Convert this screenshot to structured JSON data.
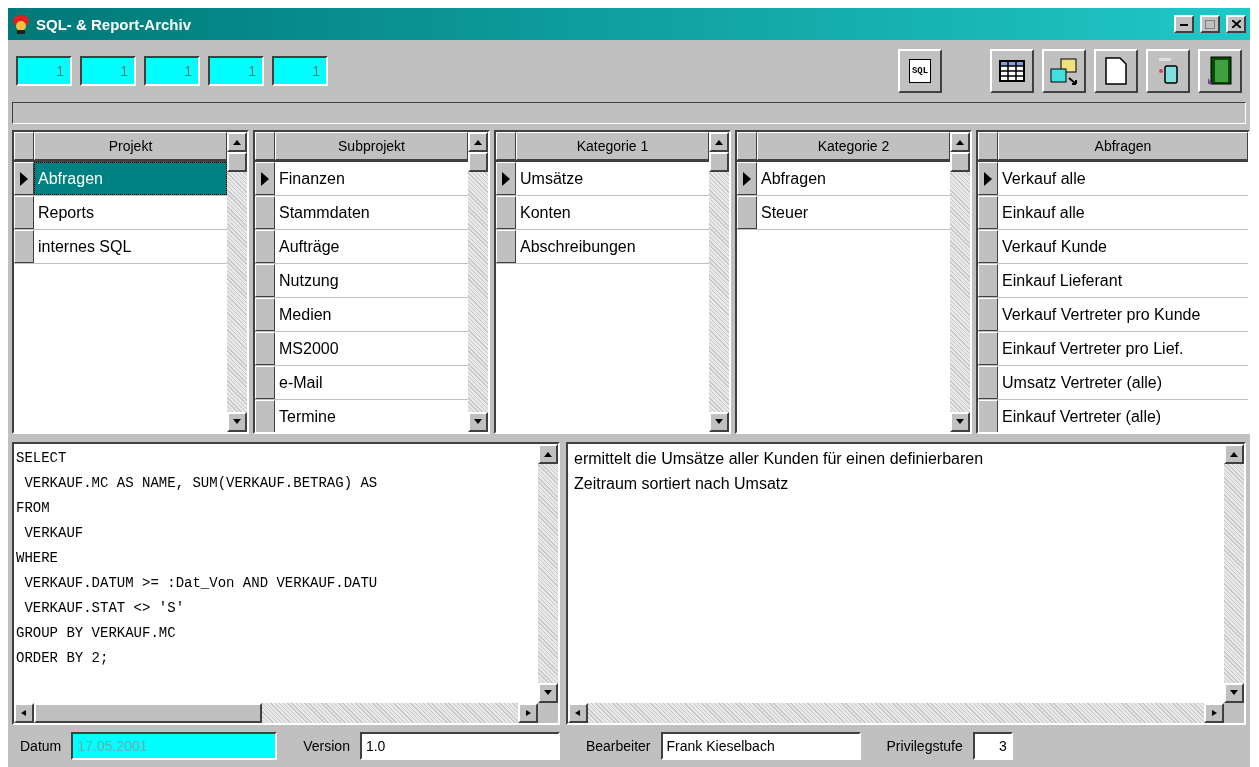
{
  "window": {
    "title": "SQL- & Report-Archiv"
  },
  "counters": [
    "1",
    "1",
    "1",
    "1",
    "1"
  ],
  "sql_button": {
    "label": "SQL"
  },
  "grids": [
    {
      "header": "Projekt",
      "focused": true,
      "scrollbar": true,
      "rows": [
        {
          "text": "Abfragen",
          "selected": true
        },
        {
          "text": "Reports",
          "selected": false
        },
        {
          "text": "internes SQL",
          "selected": false
        }
      ]
    },
    {
      "header": "Subprojekt",
      "focused": false,
      "scrollbar": true,
      "rows": [
        {
          "text": "Finanzen",
          "selected": true
        },
        {
          "text": "Stammdaten",
          "selected": false
        },
        {
          "text": "Aufträge",
          "selected": false
        },
        {
          "text": "Nutzung",
          "selected": false
        },
        {
          "text": "Medien",
          "selected": false
        },
        {
          "text": "MS2000",
          "selected": false
        },
        {
          "text": "e-Mail",
          "selected": false
        },
        {
          "text": "Termine",
          "selected": false
        }
      ]
    },
    {
      "header": "Kategorie 1",
      "focused": false,
      "scrollbar": true,
      "rows": [
        {
          "text": "Umsätze",
          "selected": true
        },
        {
          "text": "Konten",
          "selected": false
        },
        {
          "text": "Abschreibungen",
          "selected": false
        }
      ]
    },
    {
      "header": "Kategorie 2",
      "focused": false,
      "scrollbar": true,
      "rows": [
        {
          "text": "Abfragen",
          "selected": true
        },
        {
          "text": "Steuer",
          "selected": false
        }
      ]
    },
    {
      "header": "Abfragen",
      "focused": false,
      "scrollbar": false,
      "rows": [
        {
          "text": "Verkauf alle",
          "selected": true
        },
        {
          "text": "Einkauf alle",
          "selected": false
        },
        {
          "text": "Verkauf Kunde",
          "selected": false
        },
        {
          "text": "Einkauf Lieferant",
          "selected": false
        },
        {
          "text": "Verkauf Vertreter pro Kunde",
          "selected": false
        },
        {
          "text": "Einkauf Vertreter pro Lief.",
          "selected": false
        },
        {
          "text": "Umsatz Vertreter (alle)",
          "selected": false
        },
        {
          "text": "Einkauf Vertreter (alle)",
          "selected": false
        }
      ]
    }
  ],
  "sql_lines": [
    "SELECT",
    " VERKAUF.MC AS NAME, SUM(VERKAUF.BETRAG) AS",
    "FROM",
    " VERKAUF",
    "WHERE",
    " VERKAUF.DATUM >= :Dat_Von AND VERKAUF.DATU",
    " VERKAUF.STAT <> 'S'",
    "GROUP BY VERKAUF.MC",
    "ORDER BY 2;"
  ],
  "description_lines": [
    "ermittelt die Umsätze aller Kunden für einen definierbaren",
    "Zeitraum sortiert nach Umsatz"
  ],
  "status_fields": [
    {
      "label": "Datum",
      "value": "17.05.2001",
      "kind": "date",
      "disabled": true
    },
    {
      "label": "Version",
      "value": "1.0",
      "kind": "text",
      "disabled": false
    },
    {
      "label": "Bearbeiter",
      "value": "Frank Kieselbach",
      "kind": "text",
      "disabled": false
    },
    {
      "label": "Privilegstufe",
      "value": "3",
      "kind": "number",
      "disabled": false
    }
  ]
}
